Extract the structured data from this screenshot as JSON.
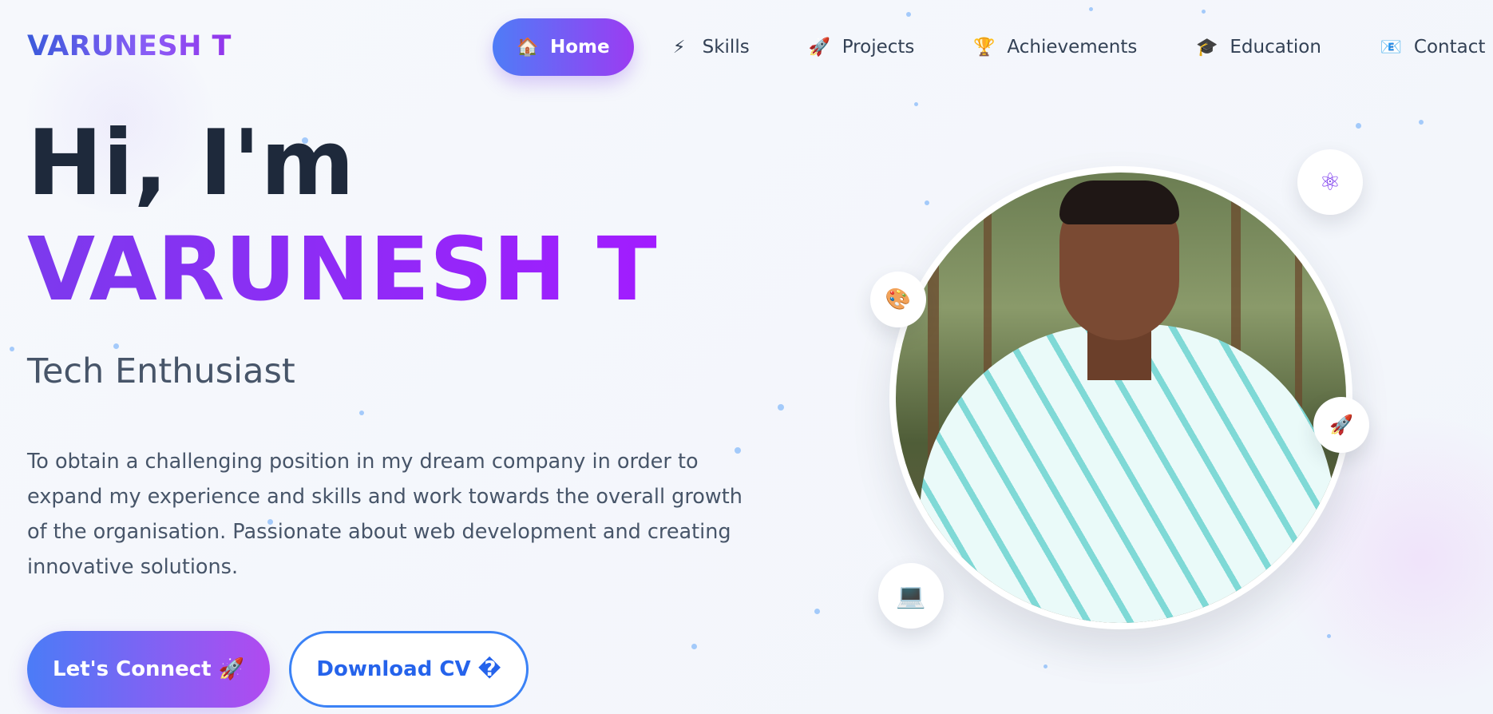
{
  "brand": {
    "logo": "VARUNESH T"
  },
  "nav": {
    "items": [
      {
        "label": "Home",
        "icon": "🏠",
        "icon_name": "home-icon",
        "active": true
      },
      {
        "label": "Skills",
        "icon": "⚡",
        "icon_name": "lightning-icon"
      },
      {
        "label": "Projects",
        "icon": "🚀",
        "icon_name": "rocket-icon"
      },
      {
        "label": "Achievements",
        "icon": "🏆",
        "icon_name": "trophy-icon"
      },
      {
        "label": "Education",
        "icon": "🎓",
        "icon_name": "graduation-cap-icon"
      },
      {
        "label": "Contact",
        "icon": "📧",
        "icon_name": "envelope-icon"
      }
    ]
  },
  "hero": {
    "greeting": "Hi, I'm",
    "name": "VARUNESH T",
    "role": "Tech Enthusiast",
    "bio": "To obtain a challenging position in my dream company in order to expand my experience and skills and work towards the overall growth of the organisation. Passionate about web development and creating innovative solutions.",
    "connect_label": "Let's Connect 🚀",
    "cv_label": "Download CV �"
  },
  "floating_badges": [
    {
      "icon": "⚛",
      "icon_name": "react-atom-icon"
    },
    {
      "icon": "🎨",
      "icon_name": "palette-icon"
    },
    {
      "icon": "🚀",
      "icon_name": "rocket-icon"
    },
    {
      "icon": "💻",
      "icon_name": "laptop-icon"
    }
  ],
  "colors": {
    "accent_blue": "#4f7cf7",
    "accent_purple": "#9b3cf2",
    "name_gradient_start": "#7c3aed",
    "name_gradient_end": "#a21cff",
    "heading": "#1e293b",
    "body_text": "#475569"
  }
}
